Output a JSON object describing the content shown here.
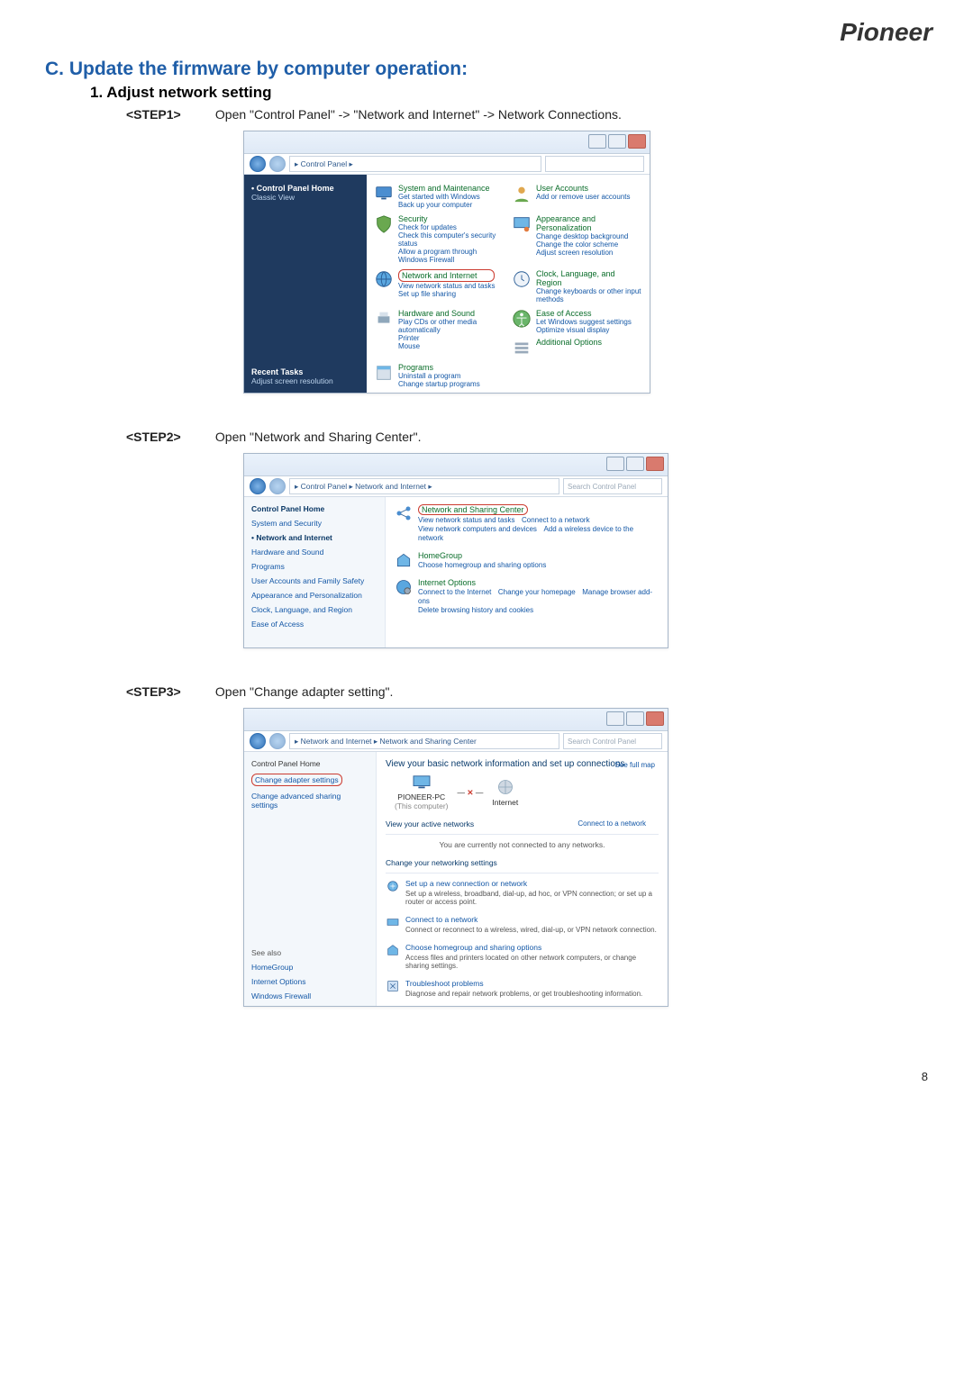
{
  "logo_text": "Pioneer",
  "page_number": "8",
  "heading_c": "C. Update the firmware by computer operation:",
  "heading_sub": "1. Adjust network setting",
  "steps": {
    "s1": {
      "label": "<STEP1>",
      "instr": "Open \"Control Panel\" -> \"Network and Internet\" -> Network Connections."
    },
    "s2": {
      "label": "<STEP2>",
      "instr": "Open \"Network and Sharing Center\"."
    },
    "s3": {
      "label": "<STEP3>",
      "instr": "Open \"Change adapter setting\"."
    }
  },
  "shot1": {
    "breadcrumb": "▸ Control Panel ▸",
    "sidebar": {
      "home": "Control Panel Home",
      "classic": "Classic View",
      "recent_hdr": "Recent Tasks",
      "recent_item": "Adjust screen resolution"
    },
    "cats": {
      "sys": {
        "title": "System and Maintenance",
        "l1": "Get started with Windows",
        "l2": "Back up your computer"
      },
      "usr": {
        "title": "User Accounts",
        "l1": "Add or remove user accounts"
      },
      "sec": {
        "title": "Security",
        "l1": "Check for updates",
        "l2": "Check this computer's security status",
        "l3": "Allow a program through Windows Firewall"
      },
      "app": {
        "title": "Appearance and Personalization",
        "l1": "Change desktop background",
        "l2": "Change the color scheme",
        "l3": "Adjust screen resolution"
      },
      "net": {
        "title": "Network and Internet",
        "l1": "View network status and tasks",
        "l2": "Set up file sharing"
      },
      "clk": {
        "title": "Clock, Language, and Region",
        "l1": "Change keyboards or other input methods"
      },
      "hw": {
        "title": "Hardware and Sound",
        "l1": "Play CDs or other media automatically",
        "l2": "Printer",
        "l3": "Mouse"
      },
      "ease": {
        "title": "Ease of Access",
        "l1": "Let Windows suggest settings",
        "l2": "Optimize visual display"
      },
      "addl": {
        "title": "Additional Options"
      },
      "prog": {
        "title": "Programs",
        "l1": "Uninstall a program",
        "l2": "Change startup programs"
      }
    }
  },
  "shot2": {
    "breadcrumb": "▸ Control Panel ▸ Network and Internet ▸",
    "search": "Search Control Panel",
    "sidebar": {
      "home": "Control Panel Home",
      "items": [
        "System and Security",
        "Network and Internet",
        "Hardware and Sound",
        "Programs",
        "User Accounts and Family Safety",
        "Appearance and Personalization",
        "Clock, Language, and Region",
        "Ease of Access"
      ]
    },
    "main": {
      "nsc": {
        "title": "Network and Sharing Center",
        "l1": "View network status and tasks",
        "l2": "Connect to a network",
        "l3": "View network computers and devices",
        "l4": "Add a wireless device to the network"
      },
      "hg": {
        "title": "HomeGroup",
        "l1": "Choose homegroup and sharing options"
      },
      "io": {
        "title": "Internet Options",
        "l1": "Connect to the Internet",
        "l2": "Change your homepage",
        "l3": "Manage browser add-ons",
        "l4": "Delete browsing history and cookies"
      }
    }
  },
  "shot3": {
    "breadcrumb": "▸ Network and Internet ▸ Network and Sharing Center",
    "search": "Search Control Panel",
    "sidebar": {
      "home": "Control Panel Home",
      "chg_adapter": "Change adapter settings",
      "chg_adv": "Change advanced sharing settings",
      "see_also": "See also",
      "see": [
        "HomeGroup",
        "Internet Options",
        "Windows Firewall"
      ]
    },
    "main": {
      "banner": "View your basic network information and set up connections",
      "map_link": "See full map",
      "pc_name": "PIONEER-PC",
      "pc_sub": "(This computer)",
      "internet": "Internet",
      "active_hdr": "View your active networks",
      "active_msg": "You are currently not connected to any networks.",
      "connect_link": "Connect to a network",
      "change_hdr": "Change your networking settings",
      "tasks": {
        "t1": {
          "t": "Set up a new connection or network",
          "d": "Set up a wireless, broadband, dial-up, ad hoc, or VPN connection; or set up a router or access point."
        },
        "t2": {
          "t": "Connect to a network",
          "d": "Connect or reconnect to a wireless, wired, dial-up, or VPN network connection."
        },
        "t3": {
          "t": "Choose homegroup and sharing options",
          "d": "Access files and printers located on other network computers, or change sharing settings."
        },
        "t4": {
          "t": "Troubleshoot problems",
          "d": "Diagnose and repair network problems, or get troubleshooting information."
        }
      }
    }
  }
}
